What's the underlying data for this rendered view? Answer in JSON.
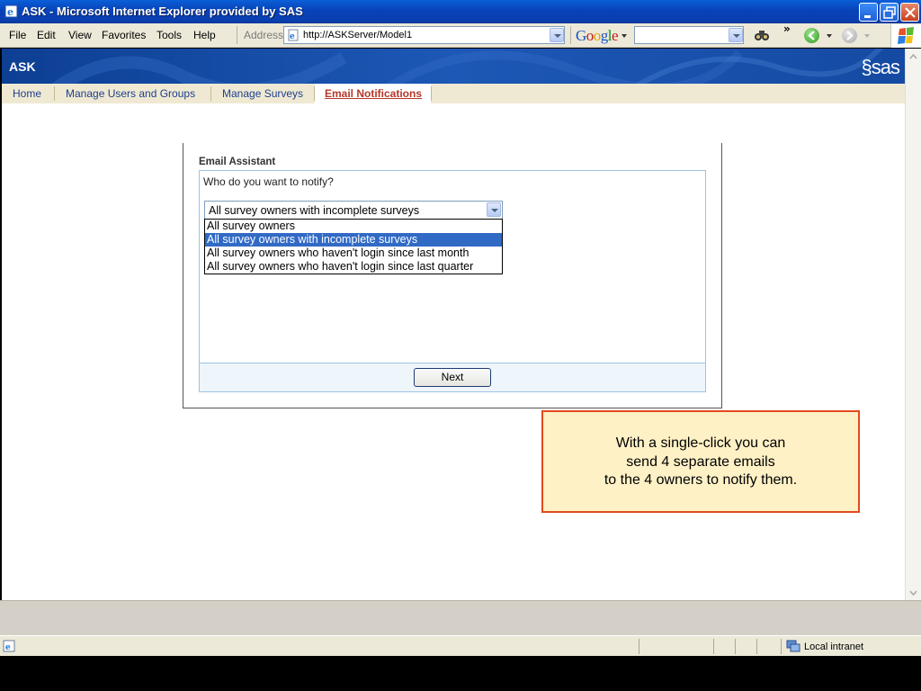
{
  "window": {
    "title": "ASK - Microsoft Internet Explorer provided by SAS"
  },
  "menu": {
    "items": [
      "File",
      "Edit",
      "View",
      "Favorites",
      "Tools",
      "Help"
    ]
  },
  "address_bar": {
    "label": "Address",
    "url": "http://ASKServer/Model1"
  },
  "toolbar": {
    "google_logo": "Google",
    "more_chevron": "»"
  },
  "app": {
    "name": "ASK",
    "brand": "sas",
    "tabs": [
      {
        "label": "Home",
        "active": false
      },
      {
        "label": "Manage Users and Groups",
        "active": false
      },
      {
        "label": "Manage Surveys",
        "active": false
      },
      {
        "label": "Email Notifications",
        "active": true
      }
    ]
  },
  "assistant": {
    "title": "Email Assistant",
    "question": "Who do you want to notify?",
    "selected_value": "All survey owners with incomplete surveys",
    "options": [
      "All survey owners",
      "All survey owners with incomplete surveys",
      "All survey owners who haven't login since last month",
      "All survey owners who haven't login since last quarter"
    ],
    "highlighted_option": 1,
    "next_label": "Next"
  },
  "callout": {
    "lines": [
      "With a single-click you can",
      "send 4 separate emails",
      "to the 4 owners to notify them."
    ]
  },
  "status": {
    "zone": "Local intranet"
  },
  "colors": {
    "title_bar": "#0842b8",
    "banner": "#1d58b6",
    "tab_active": "#b5382a",
    "tab_inactive": "#1d3f8e",
    "selection": "#316ac5",
    "callout_bg": "#fff1c6",
    "callout_border": "#e24a1f"
  }
}
